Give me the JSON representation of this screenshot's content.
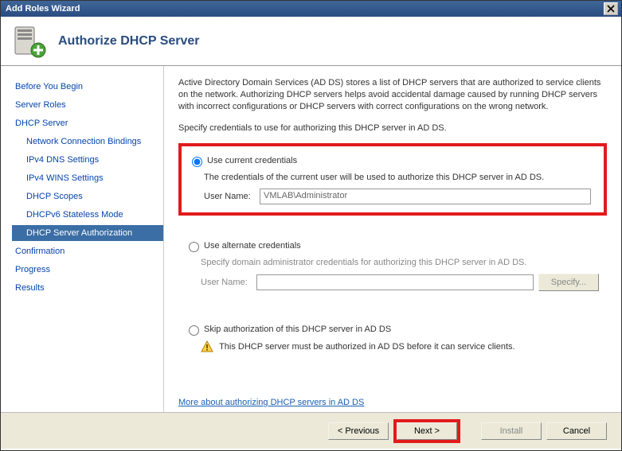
{
  "window": {
    "title": "Add Roles Wizard"
  },
  "header": {
    "title": "Authorize DHCP Server"
  },
  "sidebar": {
    "items": [
      {
        "label": "Before You Begin",
        "indent": false
      },
      {
        "label": "Server Roles",
        "indent": false
      },
      {
        "label": "DHCP Server",
        "indent": false
      },
      {
        "label": "Network Connection Bindings",
        "indent": true
      },
      {
        "label": "IPv4 DNS Settings",
        "indent": true
      },
      {
        "label": "IPv4 WINS Settings",
        "indent": true
      },
      {
        "label": "DHCP Scopes",
        "indent": true
      },
      {
        "label": "DHCPv6 Stateless Mode",
        "indent": true
      },
      {
        "label": "DHCP Server Authorization",
        "indent": true,
        "selected": true
      },
      {
        "label": "Confirmation",
        "indent": false
      },
      {
        "label": "Progress",
        "indent": false
      },
      {
        "label": "Results",
        "indent": false
      }
    ]
  },
  "content": {
    "intro": "Active Directory Domain Services (AD DS) stores a list of DHCP servers that are authorized to service clients on the network. Authorizing DHCP servers helps avoid accidental damage caused by running DHCP servers with incorrect configurations or DHCP servers with correct configurations on the wrong network.",
    "specify": "Specify credentials to use for authorizing this DHCP server in AD DS.",
    "opt_current": {
      "label": "Use current credentials",
      "desc": "The credentials of the current user will be used to authorize this DHCP server in AD DS.",
      "user_label": "User Name:",
      "user_value": "VMLAB\\Administrator"
    },
    "opt_alternate": {
      "label": "Use alternate credentials",
      "desc": "Specify domain administrator credentials for authorizing this DHCP server in AD DS.",
      "user_label": "User Name:",
      "user_value": "",
      "specify_btn": "Specify..."
    },
    "opt_skip": {
      "label": "Skip authorization of this DHCP server in AD DS",
      "warning": "This DHCP server must be authorized in AD DS before it can service clients."
    },
    "help_link": "More about authorizing DHCP servers in AD DS"
  },
  "footer": {
    "previous": "< Previous",
    "next": "Next >",
    "install": "Install",
    "cancel": "Cancel"
  }
}
